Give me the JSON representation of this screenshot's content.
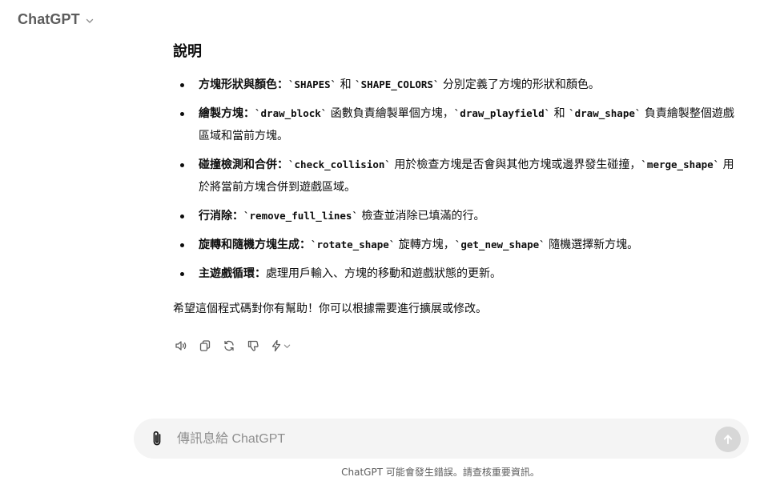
{
  "header": {
    "model_label": "ChatGPT"
  },
  "message": {
    "heading": "說明",
    "points": [
      {
        "label": "方塊形狀與顏色：",
        "parts": [
          "`SHAPES`",
          " 和 ",
          "`SHAPE_COLORS`",
          " 分別定義了方塊的形狀和顏色。"
        ]
      },
      {
        "label": "繪製方塊：",
        "parts": [
          "`draw_block`",
          " 函數負責繪製單個方塊，",
          "`draw_playfield`",
          " 和 ",
          "`draw_shape`",
          " 負責繪製整個遊戲區域和當前方塊。"
        ]
      },
      {
        "label": "碰撞檢測和合併：",
        "parts": [
          "`check_collision`",
          " 用於檢查方塊是否會與其他方塊或邊界發生碰撞，",
          "`merge_shape`",
          " 用於將當前方塊合併到遊戲區域。"
        ]
      },
      {
        "label": "行消除：",
        "parts": [
          "`remove_full_lines`",
          " 檢查並消除已填滿的行。"
        ]
      },
      {
        "label": "旋轉和隨機方塊生成：",
        "parts": [
          "`rotate_shape`",
          " 旋轉方塊，",
          "`get_new_shape`",
          " 隨機選擇新方塊。"
        ]
      },
      {
        "label": "主遊戲循環：",
        "parts": [
          "處理用戶輸入、方塊的移動和遊戲狀態的更新。"
        ]
      }
    ],
    "closing": "希望這個程式碼對你有幫助！你可以根據需要進行擴展或修改。"
  },
  "actions": [
    {
      "name": "read-aloud-button",
      "icon": "speaker-icon"
    },
    {
      "name": "copy-button",
      "icon": "copy-icon"
    },
    {
      "name": "regenerate-button",
      "icon": "refresh-icon"
    },
    {
      "name": "thumbs-down-button",
      "icon": "thumbs-down-icon"
    },
    {
      "name": "model-switch-button",
      "icon": "lightning-icon"
    }
  ],
  "composer": {
    "placeholder": "傳訊息給 ChatGPT",
    "value": ""
  },
  "footer": {
    "disclaimer": "ChatGPT 可能會發生錯誤。請查核重要資訊。"
  },
  "colors": {
    "composer_bg": "#f4f4f4",
    "send_button_disabled": "#d7d7d7",
    "muted_text": "#5d5d5d"
  }
}
